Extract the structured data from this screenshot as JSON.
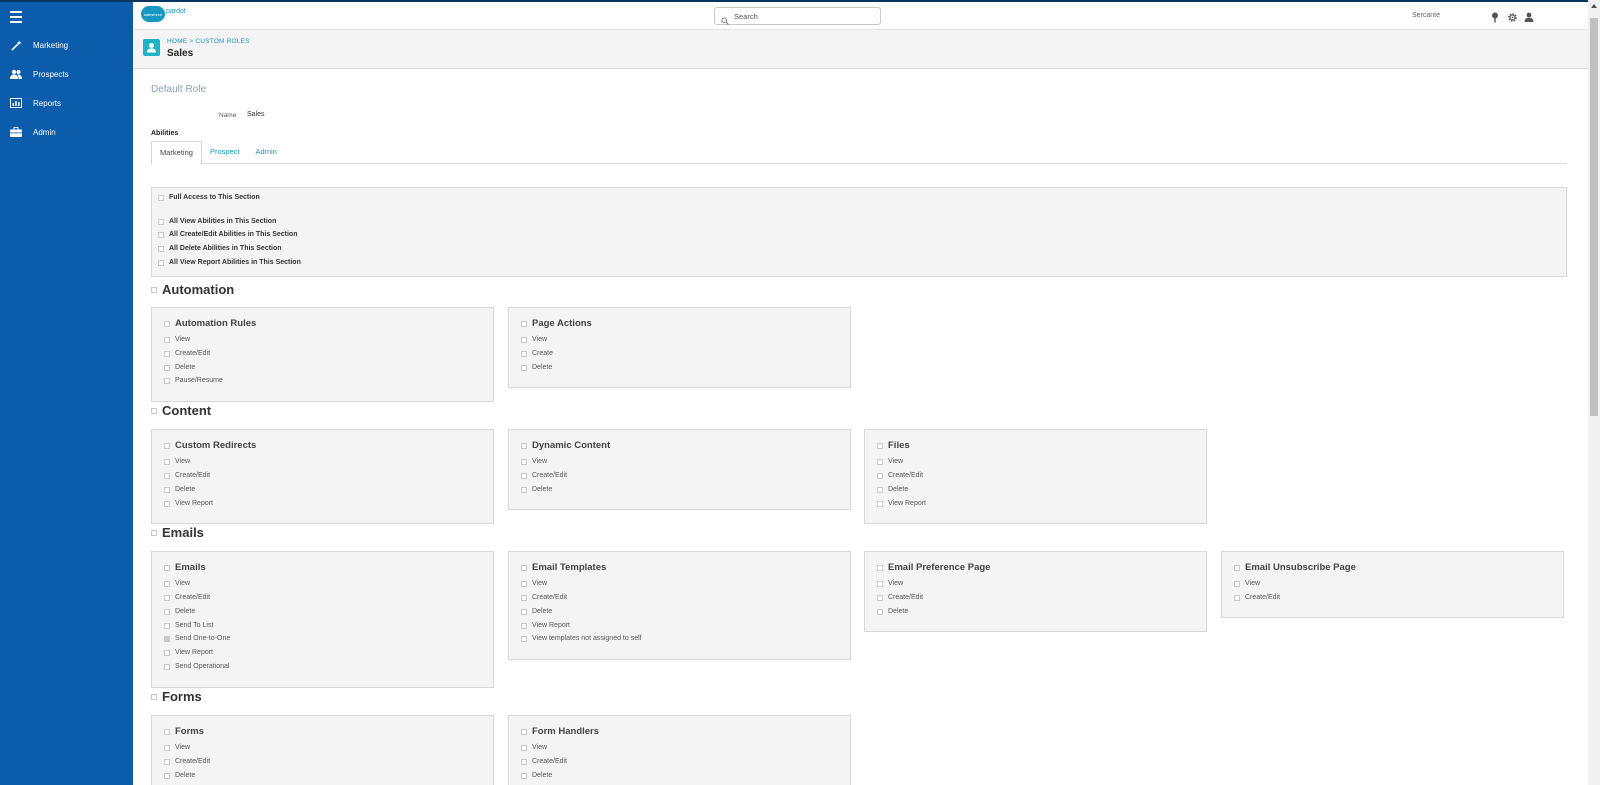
{
  "sidebar": {
    "items": [
      {
        "label": "Marketing",
        "icon": "magic-wand-icon"
      },
      {
        "label": "Prospects",
        "icon": "people-icon"
      },
      {
        "label": "Reports",
        "icon": "report-icon"
      },
      {
        "label": "Admin",
        "icon": "briefcase-icon"
      }
    ]
  },
  "topbar": {
    "logo_cloud": "salesforce",
    "logo_product": "pardot",
    "search_placeholder": "Search",
    "user_name": "Sercante"
  },
  "header": {
    "breadcrumb_home": "HOME",
    "breadcrumb_sep": ">",
    "breadcrumb_current": "CUSTOM ROLES",
    "title": "Sales"
  },
  "form": {
    "default_role": "Default Role",
    "name_label": "Name",
    "name_value": "Sales",
    "abilities_label": "Abilities"
  },
  "tabs": [
    "Marketing",
    "Prospect",
    "Admin"
  ],
  "active_tab": "Marketing",
  "full_access": {
    "full": "Full Access to This Section",
    "view_all": "All View Abilities in This Section",
    "create_all": "All Create/Edit Abilities in This Section",
    "delete_all": "All Delete Abilities in This Section",
    "report_all": "All View Report Abilities in This Section"
  },
  "sections": {
    "automation": {
      "title": "Automation",
      "cards": [
        {
          "title": "Automation Rules",
          "options": [
            "View",
            "Create/Edit",
            "Delete",
            "Pause/Resume"
          ]
        },
        {
          "title": "Page Actions",
          "options": [
            "View",
            "Create",
            "Delete"
          ]
        }
      ]
    },
    "content": {
      "title": "Content",
      "cards": [
        {
          "title": "Custom Redirects",
          "options": [
            "View",
            "Create/Edit",
            "Delete",
            "View Report"
          ]
        },
        {
          "title": "Dynamic Content",
          "options": [
            "View",
            "Create/Edit",
            "Delete"
          ]
        },
        {
          "title": "Files",
          "options": [
            "View",
            "Create/Edit",
            "Delete",
            "View Report"
          ]
        }
      ]
    },
    "emails": {
      "title": "Emails",
      "cards": [
        {
          "title": "Emails",
          "options": [
            "View",
            "Create/Edit",
            "Delete",
            "Send To List",
            "Send One-to-One",
            "View Report",
            "Send Operational"
          ],
          "checked_option": "Send One-to-One"
        },
        {
          "title": "Email Templates",
          "options": [
            "View",
            "Create/Edit",
            "Delete",
            "View Report",
            "View templates not assigned to self"
          ]
        },
        {
          "title": "Email Preference Page",
          "options": [
            "View",
            "Create/Edit",
            "Delete"
          ]
        },
        {
          "title": "Email Unsubscribe Page",
          "options": [
            "View",
            "Create/Edit"
          ]
        }
      ]
    },
    "forms": {
      "title": "Forms",
      "cards": [
        {
          "title": "Forms",
          "options": [
            "View",
            "Create/Edit",
            "Delete"
          ]
        },
        {
          "title": "Form Handlers",
          "options": [
            "View",
            "Create/Edit",
            "Delete"
          ]
        }
      ]
    }
  }
}
